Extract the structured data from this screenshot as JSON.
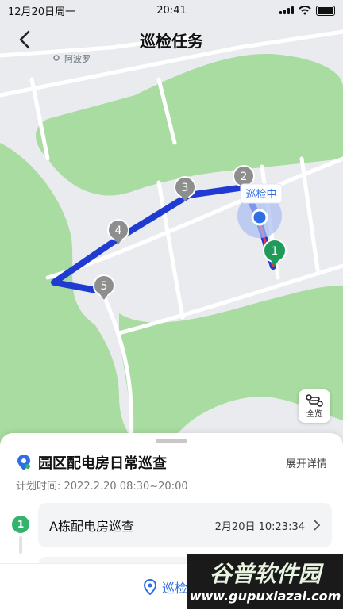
{
  "status_bar": {
    "date": "12月20日周一",
    "time": "20:41"
  },
  "nav": {
    "title": "巡检任务"
  },
  "map": {
    "place_label": "阿波罗",
    "current_tag": "巡检中",
    "markers": [
      "1",
      "2",
      "3",
      "4",
      "5"
    ],
    "overview_label": "全览"
  },
  "task": {
    "title": "园区配电房日常巡查",
    "detail_link": "展开详情",
    "plan_time": "计划时间: 2022.2.20 08:30~20:00"
  },
  "points": [
    {
      "index": "1",
      "name": "A栋配电房巡查",
      "time": "2月20日 10:23:34"
    }
  ],
  "bottom": {
    "patrol_label": "巡检点"
  },
  "watermark": {
    "main": "谷普软件园",
    "url": "www.gupuxlazal.com"
  },
  "colors": {
    "route": "#2f4fd8",
    "green": "#33b36b",
    "accent": "#2f6fe6",
    "greenery": "#a8dca0"
  }
}
